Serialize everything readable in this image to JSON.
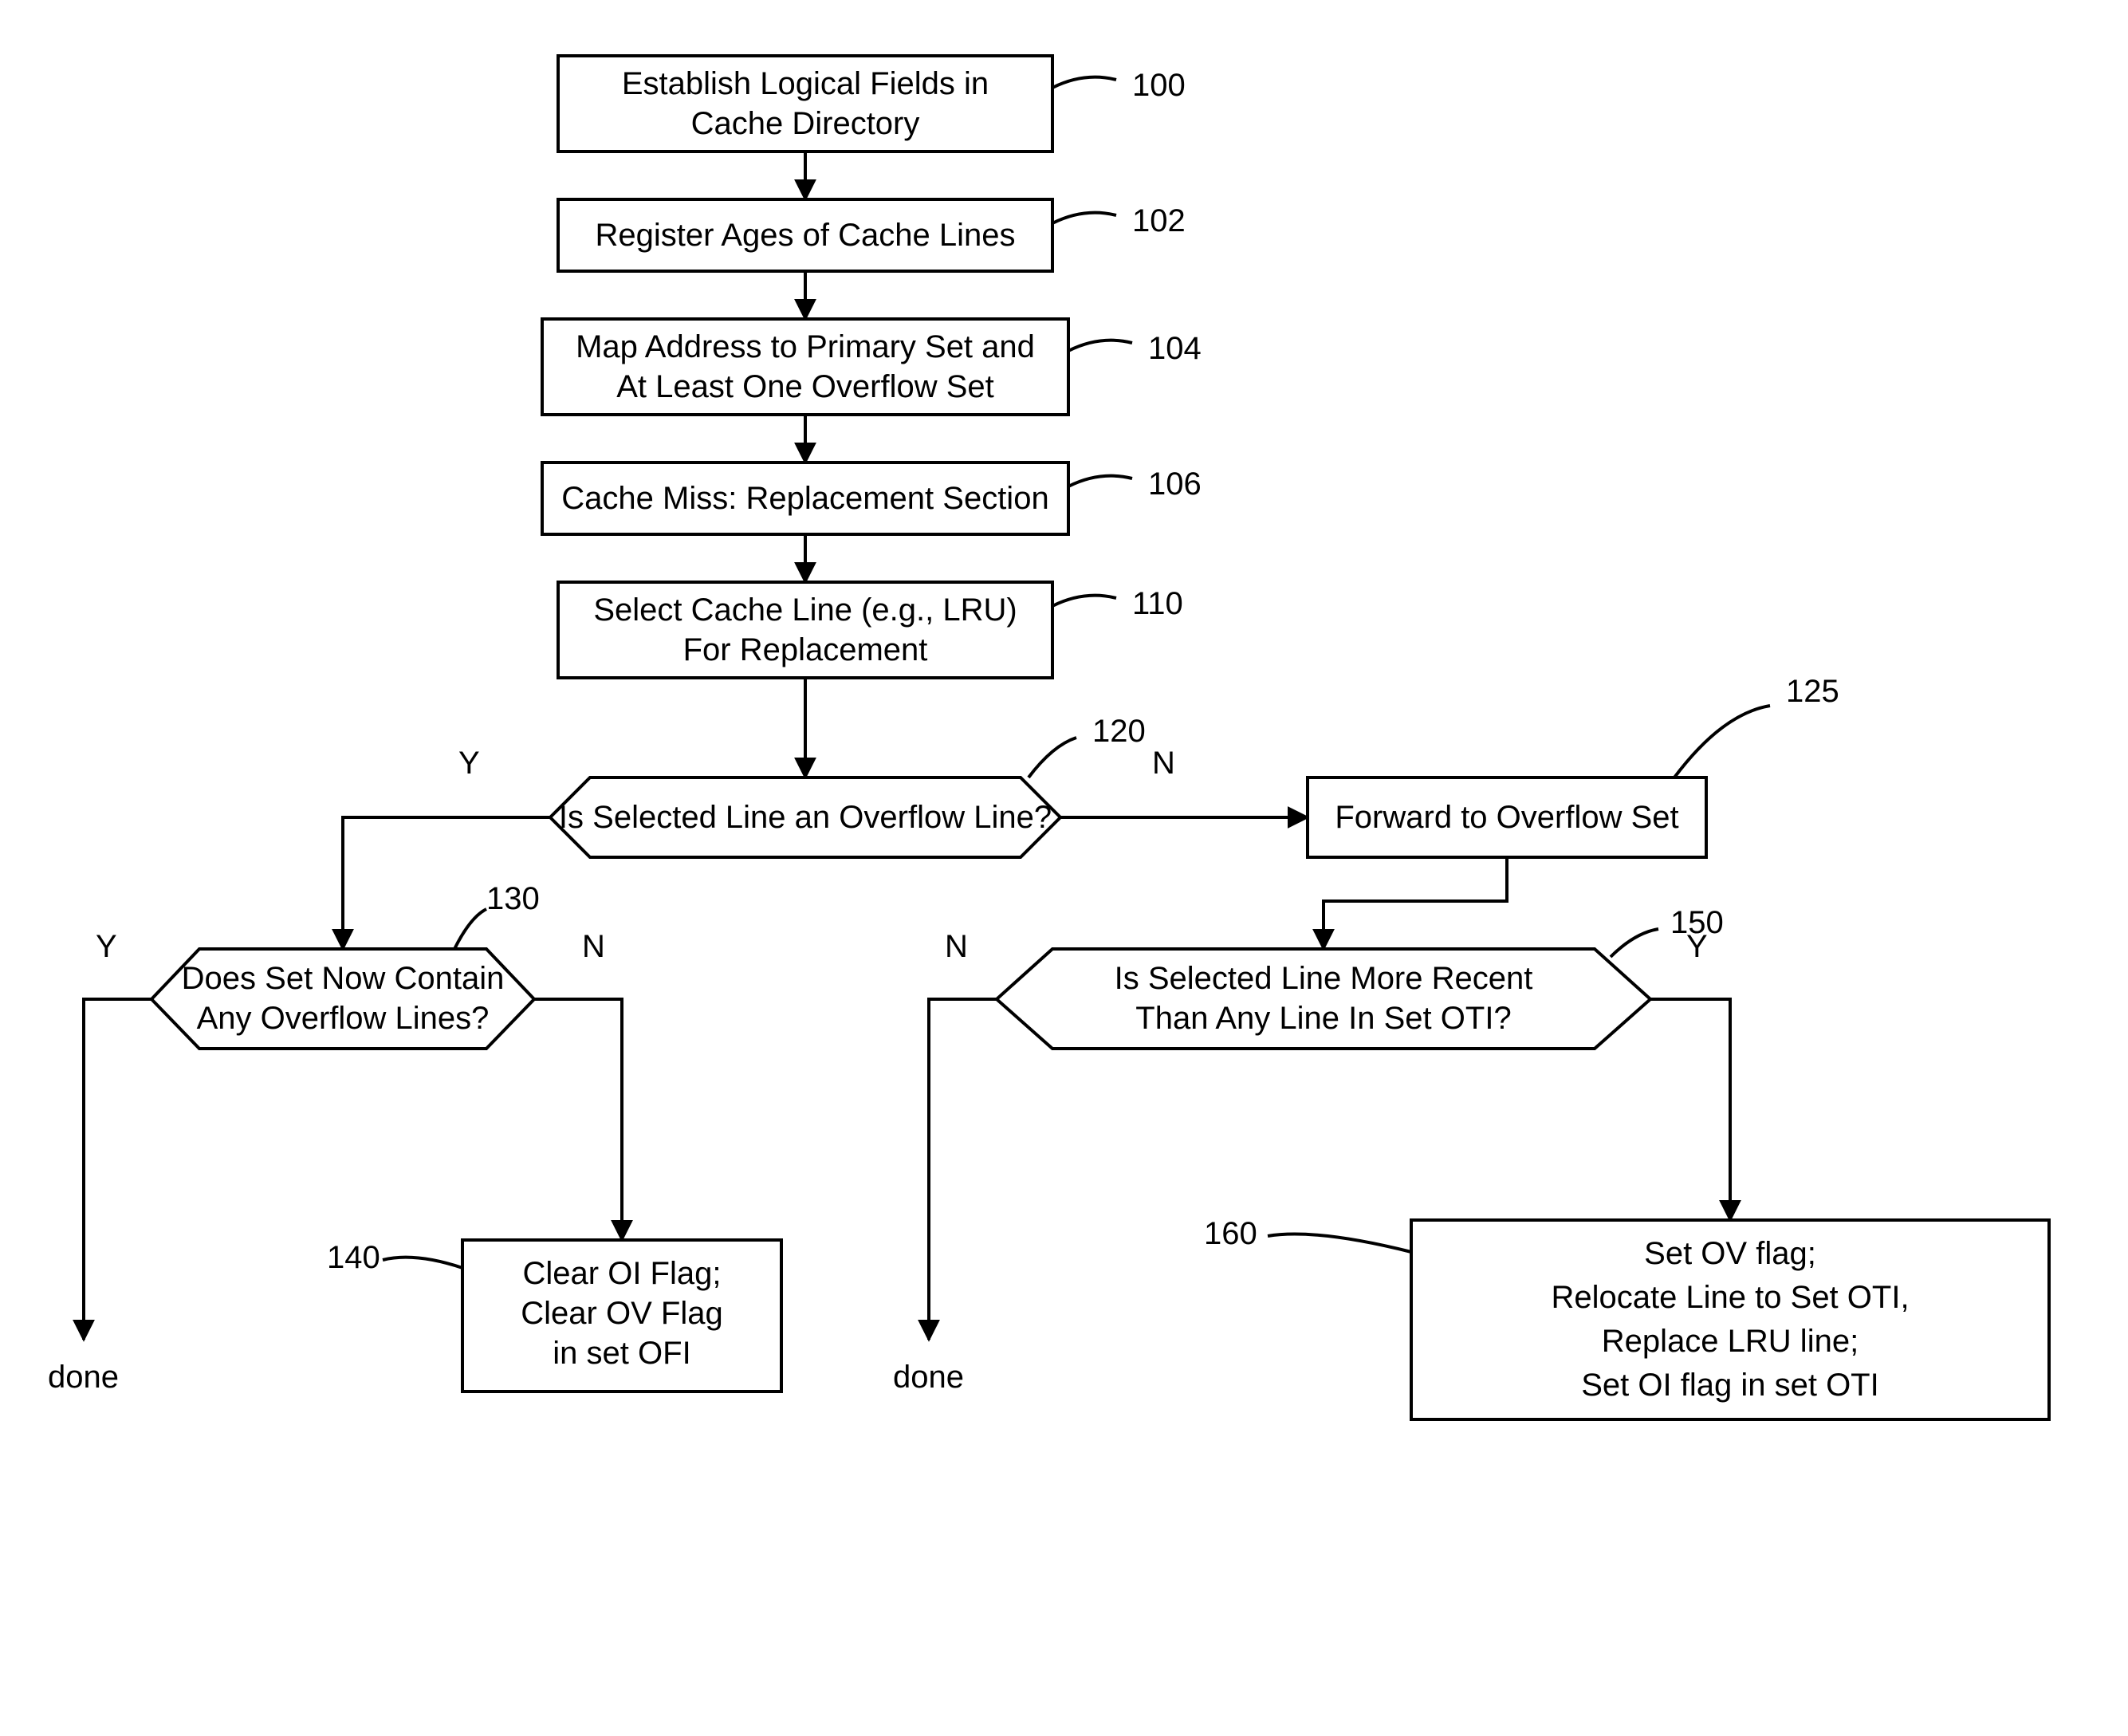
{
  "boxes": {
    "b100": {
      "ref": "100",
      "lines": [
        "Establish Logical Fields in",
        "Cache Directory"
      ]
    },
    "b102": {
      "ref": "102",
      "lines": [
        "Register Ages of Cache Lines"
      ]
    },
    "b104": {
      "ref": "104",
      "lines": [
        "Map Address to Primary Set and",
        "At Least One Overflow Set"
      ]
    },
    "b106": {
      "ref": "106",
      "lines": [
        "Cache Miss: Replacement Section"
      ]
    },
    "b110": {
      "ref": "110",
      "lines": [
        "Select Cache Line (e.g., LRU)",
        "For Replacement"
      ]
    },
    "b125": {
      "ref": "125",
      "lines": [
        "Forward to Overflow Set"
      ]
    },
    "b140": {
      "ref": "140",
      "lines": [
        "Clear OI Flag;",
        "Clear OV Flag",
        "in set OFI"
      ]
    },
    "b160": {
      "ref": "160",
      "lines": [
        "Set OV flag;",
        "Relocate Line to Set OTI,",
        "Replace LRU line;",
        "Set OI flag in set OTI"
      ]
    }
  },
  "decisions": {
    "d120": {
      "ref": "120",
      "text": "Is Selected Line an Overflow Line?",
      "yes": "Y",
      "no": "N"
    },
    "d130": {
      "ref": "130",
      "text": [
        "Does Set Now Contain",
        "Any Overflow Lines?"
      ],
      "yes": "Y",
      "no": "N"
    },
    "d150": {
      "ref": "150",
      "text": [
        "Is Selected Line More Recent",
        "Than Any Line In Set OTI?"
      ],
      "yes": "Y",
      "no": "N"
    }
  },
  "terminals": {
    "done1": "done",
    "done2": "done"
  }
}
